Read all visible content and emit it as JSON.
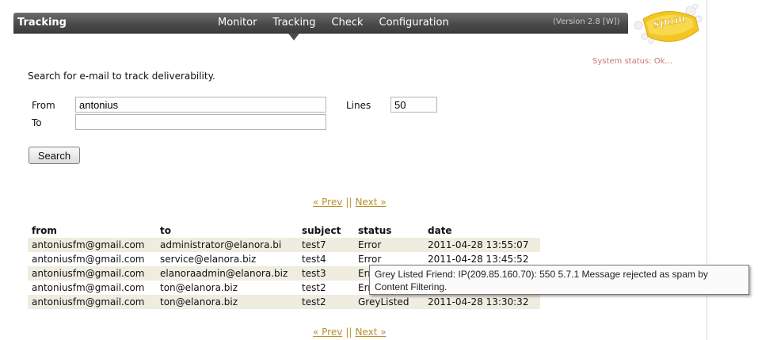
{
  "header": {
    "title": "Tracking",
    "nav": [
      "Monitor",
      "Tracking",
      "Check",
      "Configuration"
    ],
    "active_nav": "Tracking",
    "version": "(Version 2.8 [W])",
    "logo_text": "spam"
  },
  "system_status": "System status: Ok...",
  "search": {
    "intro": "Search for e-mail to track deliverability.",
    "from_label": "From",
    "from_value": "antonius",
    "to_label": "To",
    "to_value": "",
    "lines_label": "Lines",
    "lines_value": "50",
    "button": "Search"
  },
  "pager": {
    "prev": "« Prev",
    "sep": "||",
    "next": "Next »"
  },
  "table": {
    "columns": [
      "from",
      "to",
      "subject",
      "status",
      "date"
    ],
    "rows": [
      [
        "antoniusfm@gmail.com",
        "administrator@elanora.bi",
        "test7",
        "Error",
        "2011-04-28 13:55:07"
      ],
      [
        "antoniusfm@gmail.com",
        "service@elanora.biz",
        "test4",
        "Error",
        "2011-04-28 13:45:52"
      ],
      [
        "antoniusfm@gmail.com",
        "elanoraadmin@elanora.biz",
        "test3",
        "Err",
        ""
      ],
      [
        "antoniusfm@gmail.com",
        "ton@elanora.biz",
        "test2",
        "Err",
        ""
      ],
      [
        "antoniusfm@gmail.com",
        "ton@elanora.biz",
        "test2",
        "GreyListed",
        "2011-04-28 13:30:32"
      ]
    ]
  },
  "tooltip": "Grey Listed Friend: IP(209.85.160.70): 550 5.7.1 Message rejected as spam by Content Filtering.",
  "colors": {
    "accent_link": "#b88f2e",
    "row_highlight": "#efece0",
    "status_text": "#c9766f",
    "header_bar": "#4a4a4a"
  }
}
